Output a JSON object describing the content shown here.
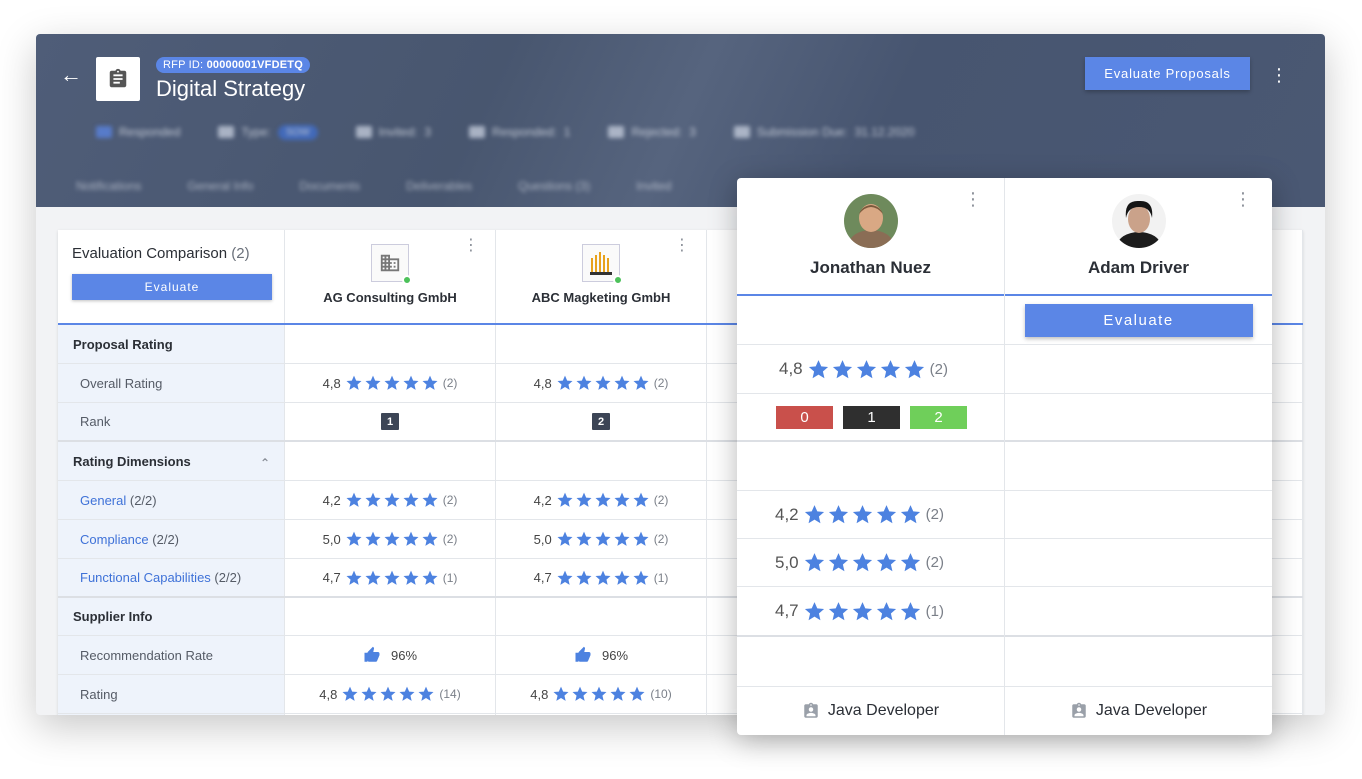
{
  "header": {
    "back_icon": "arrow-left-icon",
    "rfp_label": "RFP ID:",
    "rfp_id": "00000001VFDETQ",
    "title": "Digital Strategy",
    "evaluate_proposals_label": "Evaluate Proposals",
    "meta": [
      {
        "label": "Responded"
      },
      {
        "label": "Type:",
        "value": "SOW"
      },
      {
        "label": "Invited:",
        "value": "3"
      },
      {
        "label": "Responded:",
        "value": "1"
      },
      {
        "label": "Rejected:",
        "value": "3"
      },
      {
        "label": "Submission Due:",
        "value": "31.12.2020"
      }
    ],
    "tabs": [
      "Notifications",
      "General Info",
      "Documents",
      "Deliverables",
      "Questions (3)",
      "Invited"
    ]
  },
  "comparison": {
    "title": "Evaluation Comparison",
    "count": "(2)",
    "evaluate_label": "Evaluate",
    "suppliers": [
      {
        "name": "AG Consulting GmbH",
        "logo": "building-icon"
      },
      {
        "name": "ABC Magketing GmbH",
        "logo": "asgard-logo"
      }
    ],
    "sections": {
      "proposal_rating": "Proposal Rating",
      "rating_dimensions": "Rating Dimensions",
      "supplier_info": "Supplier Info"
    },
    "rows": {
      "overall_rating": {
        "label": "Overall Rating",
        "values": [
          {
            "score": "4,8",
            "count": "(2)"
          },
          {
            "score": "4,8",
            "count": "(2)"
          }
        ]
      },
      "rank": {
        "label": "Rank",
        "values": [
          "1",
          "2"
        ]
      },
      "general": {
        "label": "General",
        "suffix": "(2/2)",
        "values": [
          {
            "score": "4,2",
            "count": "(2)"
          },
          {
            "score": "4,2",
            "count": "(2)"
          }
        ]
      },
      "compliance": {
        "label": "Compliance",
        "suffix": "(2/2)",
        "values": [
          {
            "score": "5,0",
            "count": "(2)"
          },
          {
            "score": "5,0",
            "count": "(2)"
          }
        ]
      },
      "functional": {
        "label": "Functional Capabilities",
        "suffix": "(2/2)",
        "values": [
          {
            "score": "4,7",
            "count": "(1)"
          },
          {
            "score": "4,7",
            "count": "(1)"
          }
        ]
      },
      "recommendation": {
        "label": "Recommendation Rate",
        "values": [
          "96%",
          "96%"
        ]
      },
      "rating": {
        "label": "Rating",
        "values": [
          {
            "score": "4,8",
            "count": "(14)"
          },
          {
            "score": "4,8",
            "count": "(10)"
          }
        ]
      }
    }
  },
  "overlay": {
    "people": [
      {
        "name": "Jonathan Nuez",
        "role": "Java Developer"
      },
      {
        "name": "Adam Driver",
        "role": "Java Developer"
      }
    ],
    "evaluate_label": "Evaluate",
    "overall": {
      "score": "4,8",
      "count": "(2)"
    },
    "votes": [
      {
        "value": "0",
        "color": "#c9504b"
      },
      {
        "value": "1",
        "color": "#2f2f2f"
      },
      {
        "value": "2",
        "color": "#6fcf5a"
      }
    ],
    "dimensions": [
      {
        "score": "4,2",
        "count": "(2)"
      },
      {
        "score": "5,0",
        "count": "(2)"
      },
      {
        "score": "4,7",
        "count": "(1)"
      }
    ]
  },
  "colors": {
    "accent": "#5b86e6",
    "header": "#4f5d78",
    "star": "#4d82e0"
  }
}
